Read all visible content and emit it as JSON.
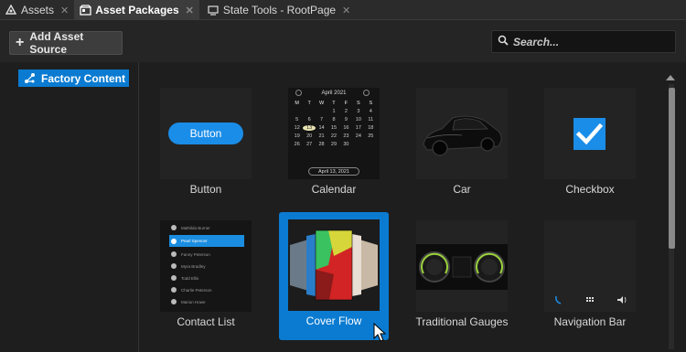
{
  "tabs": [
    {
      "label": "Assets",
      "icon": "assets-icon",
      "active": false,
      "close": "✕"
    },
    {
      "label": "Asset Packages",
      "icon": "packages-icon",
      "active": true,
      "close": "✕"
    },
    {
      "label": "State Tools - RootPage",
      "icon": "window-icon",
      "active": false,
      "close": "✕"
    }
  ],
  "toolbar": {
    "add_label": "Add Asset Source",
    "add_icon": "plus-icon",
    "search_placeholder": "Search..."
  },
  "tree": {
    "items": [
      {
        "label": "Factory Content",
        "icon": "factory-content-icon",
        "selected": true
      }
    ]
  },
  "assets": [
    {
      "label": "Button",
      "thumb_text": "Button"
    },
    {
      "label": "Calendar",
      "calendar": {
        "month": "April 2021",
        "weekdays": [
          "M",
          "T",
          "W",
          "T",
          "F",
          "S",
          "S"
        ],
        "days": [
          "",
          "",
          "",
          "1",
          "2",
          "3",
          "4",
          "5",
          "6",
          "7",
          "8",
          "9",
          "10",
          "11",
          "12",
          "13",
          "14",
          "15",
          "16",
          "17",
          "18",
          "19",
          "20",
          "21",
          "22",
          "23",
          "24",
          "25",
          "26",
          "27",
          "28",
          "29",
          "30",
          "",
          ""
        ],
        "selected_day": "13",
        "date_pill": "April 13, 2021"
      }
    },
    {
      "label": "Car"
    },
    {
      "label": "Checkbox"
    },
    {
      "label": "Contact List",
      "contacts": [
        "Mathilda Burner",
        "Pearl Spencer",
        "Fanny Peterson",
        "Myra Bradley",
        "Todd Ellis",
        "Charlie Peterson",
        "Marion Howe"
      ],
      "selected_contact": "Pearl Spencer"
    },
    {
      "label": "Cover Flow",
      "selected": true
    },
    {
      "label": "Traditional Gauges"
    },
    {
      "label": "Navigation Bar"
    }
  ],
  "colors": {
    "accent": "#0a7bd1",
    "background": "#1e1e1e",
    "tile": "#232323"
  }
}
